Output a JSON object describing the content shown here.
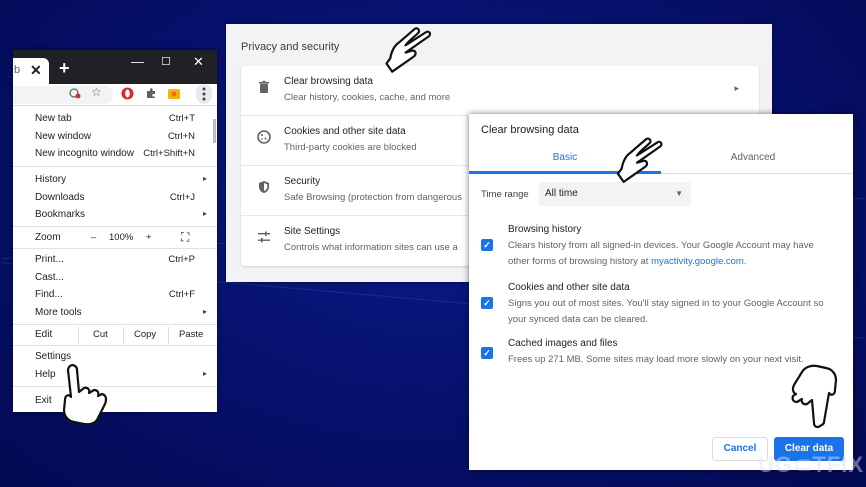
{
  "chrome_menu": {
    "tab_char": "b",
    "new_tab_symbol": "+",
    "window_controls": [
      "—",
      "☐",
      "✕"
    ],
    "toolbar_icons": [
      "red-badge-icon",
      "star-icon",
      "opera-icon",
      "extensions-puzzle-icon",
      "extension-icon",
      "kebab-menu-icon"
    ],
    "items": [
      {
        "label": "New tab",
        "shortcut": "Ctrl+T"
      },
      {
        "label": "New window",
        "shortcut": "Ctrl+N"
      },
      {
        "label": "New incognito window",
        "shortcut": "Ctrl+Shift+N"
      },
      {
        "label": "History",
        "submenu": "▸"
      },
      {
        "label": "Downloads",
        "shortcut": "Ctrl+J"
      },
      {
        "label": "Bookmarks",
        "submenu": "▸"
      },
      {
        "label": "Print...",
        "shortcut": "Ctrl+P"
      },
      {
        "label": "Cast..."
      },
      {
        "label": "Find...",
        "shortcut": "Ctrl+F"
      },
      {
        "label": "More tools",
        "submenu": "▸"
      },
      {
        "label": "Settings"
      },
      {
        "label": "Help",
        "submenu": "▸"
      },
      {
        "label": "Exit"
      }
    ],
    "zoom": {
      "label": "Zoom",
      "minus": "–",
      "value": "100%",
      "plus": "+",
      "fullscreen": "⛶"
    },
    "edit": {
      "label": "Edit",
      "cut": "Cut",
      "copy": "Copy",
      "paste": "Paste"
    }
  },
  "privacy": {
    "title": "Privacy and security",
    "rows": [
      {
        "icon": "trash-icon",
        "title": "Clear browsing data",
        "subtitle": "Clear history, cookies, cache, and more",
        "arrow": "▸"
      },
      {
        "icon": "cookie-icon",
        "title": "Cookies and other site data",
        "subtitle": "Third-party cookies are blocked"
      },
      {
        "icon": "shield-icon",
        "title": "Security",
        "subtitle": "Safe Browsing (protection from dangerous"
      },
      {
        "icon": "sliders-icon",
        "title": "Site Settings",
        "subtitle": "Controls what information sites can use a"
      }
    ]
  },
  "dialog": {
    "title": "Clear browsing data",
    "tabs": [
      "Basic",
      "Advanced"
    ],
    "time_range_label": "Time range",
    "time_range_value": "All time",
    "options": [
      {
        "title": "Browsing history",
        "desc": "Clears history from all signed-in devices. Your Google Account may have other forms of browsing history at ",
        "link": "myactivity.google.com",
        "desc_end": ".",
        "checked": true
      },
      {
        "title": "Cookies and other site data",
        "desc": "Signs you out of most sites. You'll stay signed in to your Google Account so your synced data can be cleared.",
        "checked": true
      },
      {
        "title": "Cached images and files",
        "desc": "Frees up 271 MB. Some sites may load more slowly on your next visit.",
        "checked": true
      }
    ],
    "cancel_label": "Cancel",
    "clear_label": "Clear data"
  },
  "logo_text": "UG⊂TFIX",
  "colors": {
    "accent": "#1a73e8",
    "background": "#06106b"
  }
}
